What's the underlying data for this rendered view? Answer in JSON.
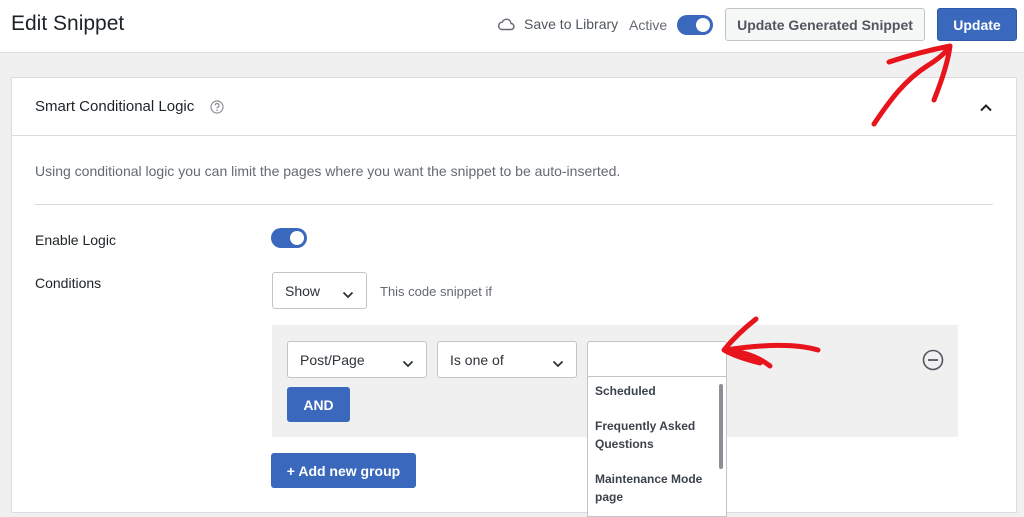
{
  "header": {
    "title": "Edit Snippet",
    "save_to_library": "Save to Library",
    "active_label": "Active",
    "active_on": true,
    "update_generated_label": "Update Generated Snippet",
    "update_label": "Update"
  },
  "panel": {
    "title": "Smart Conditional Logic",
    "description": "Using conditional logic you can limit the pages where you want the snippet to be auto-inserted.",
    "enable_logic_label": "Enable Logic",
    "enable_logic_on": true,
    "conditions_label": "Conditions",
    "show_select": "Show",
    "hint": "This code snippet if",
    "rule": {
      "field": "Post/Page",
      "operator": "Is one of",
      "value": ""
    },
    "and_label": "AND",
    "add_group_label": "+ Add new group",
    "dropdown_options": [
      "Scheduled",
      "Frequently Asked Questions",
      "Maintenance Mode page"
    ]
  },
  "colors": {
    "primary": "#3968bd",
    "annotation": "#e8141c"
  },
  "icons": [
    "cloud-icon",
    "help-icon",
    "chevron-up-icon",
    "chevron-down-icon",
    "minus-circle-icon"
  ]
}
